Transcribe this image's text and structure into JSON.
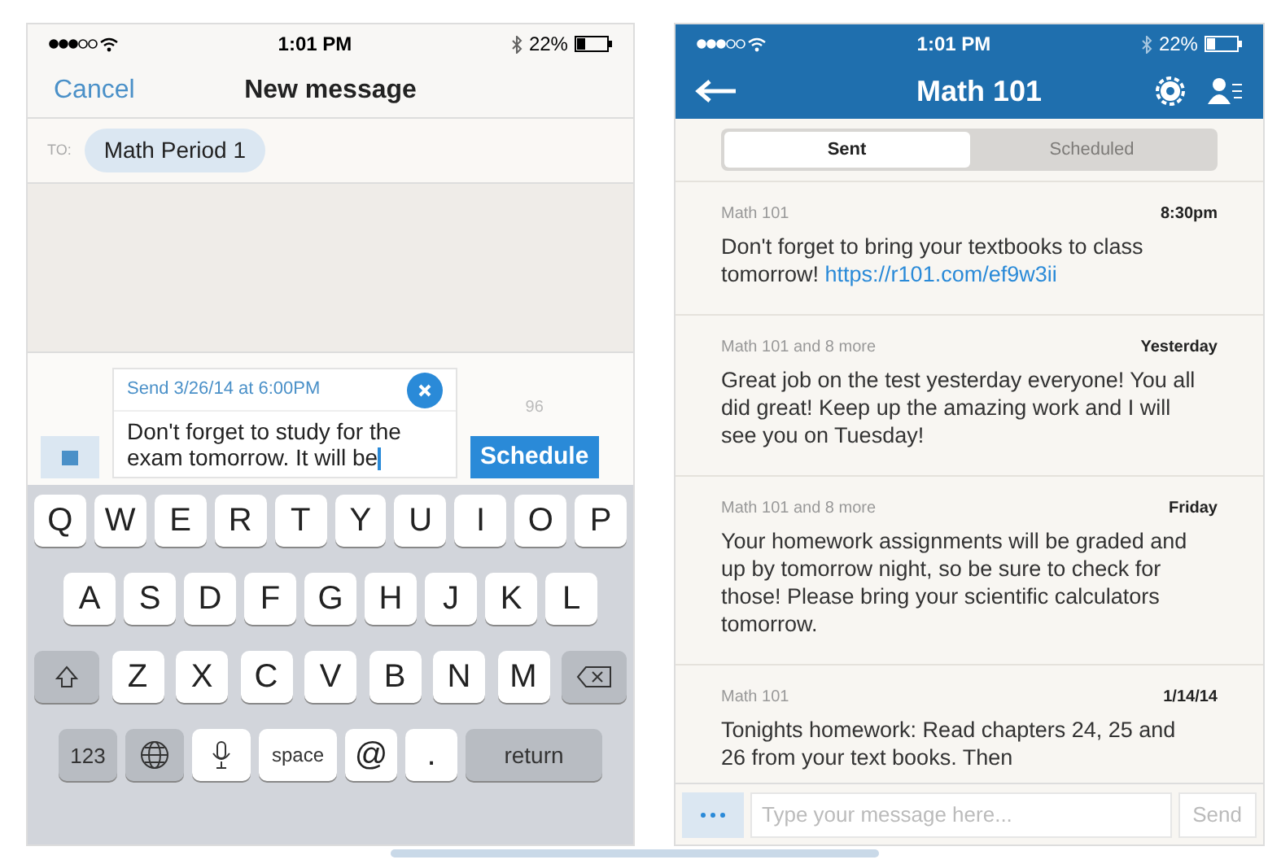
{
  "left": {
    "status_bar": {
      "time": "1:01 PM",
      "battery": "22%"
    },
    "nav": {
      "cancel": "Cancel",
      "title": "New message"
    },
    "to": {
      "label": "TO:",
      "recipient": "Math Period 1"
    },
    "compose": {
      "schedule_note": "Send 3/26/14 at 6:00PM",
      "text": "Don't forget to study for the exam tomorrow. It will be",
      "char_count": "96",
      "schedule_button": "Schedule"
    },
    "keyboard": {
      "rows": [
        {
          "keys": [
            {
              "kind": "letter",
              "label": "Q"
            },
            {
              "kind": "letter",
              "label": "W"
            },
            {
              "kind": "letter",
              "label": "E"
            },
            {
              "kind": "letter",
              "label": "R"
            },
            {
              "kind": "letter",
              "label": "T"
            },
            {
              "kind": "letter",
              "label": "Y"
            },
            {
              "kind": "letter",
              "label": "U"
            },
            {
              "kind": "letter",
              "label": "I"
            },
            {
              "kind": "letter",
              "label": "O"
            },
            {
              "kind": "letter",
              "label": "P"
            }
          ]
        },
        {
          "keys": [
            {
              "kind": "letter",
              "label": "A"
            },
            {
              "kind": "letter",
              "label": "S"
            },
            {
              "kind": "letter",
              "label": "D"
            },
            {
              "kind": "letter",
              "label": "F"
            },
            {
              "kind": "letter",
              "label": "G"
            },
            {
              "kind": "letter",
              "label": "H"
            },
            {
              "kind": "letter",
              "label": "J"
            },
            {
              "kind": "letter",
              "label": "K"
            },
            {
              "kind": "letter",
              "label": "L"
            }
          ]
        },
        {
          "keys": [
            {
              "kind": "shift"
            },
            {
              "kind": "letter",
              "label": "Z"
            },
            {
              "kind": "letter",
              "label": "X"
            },
            {
              "kind": "letter",
              "label": "C"
            },
            {
              "kind": "letter",
              "label": "V"
            },
            {
              "kind": "letter",
              "label": "B"
            },
            {
              "kind": "letter",
              "label": "N"
            },
            {
              "kind": "letter",
              "label": "M"
            },
            {
              "kind": "delete"
            }
          ]
        },
        {
          "keys": [
            {
              "kind": "function",
              "label": "123"
            },
            {
              "kind": "globe"
            },
            {
              "kind": "mic"
            },
            {
              "kind": "space",
              "label": "space"
            },
            {
              "kind": "letter",
              "label": "@"
            },
            {
              "kind": "letter",
              "label": "."
            },
            {
              "kind": "return",
              "label": "return"
            }
          ]
        }
      ]
    }
  },
  "right": {
    "status_bar": {
      "time": "1:01 PM",
      "battery": "22%"
    },
    "nav": {
      "title": "Math 101"
    },
    "tabs": [
      {
        "label": "Sent",
        "selected": true
      },
      {
        "label": "Scheduled",
        "selected": false
      }
    ],
    "messages": [
      {
        "to": "Math 101",
        "time": "8:30pm",
        "text": "Don't forget to bring your textbooks to class tomorrow!",
        "link": "https://r101.com/ef9w3ii"
      },
      {
        "to": "Math 101 and 8 more",
        "time": "Yesterday",
        "text": "Great job on the test yesterday everyone! You all did great! Keep up the amazing work and I will see you on Tuesday!"
      },
      {
        "to": "Math 101 and 8 more",
        "time": "Friday",
        "text": "Your homework assignments will be graded and up by tomorrow night, so be sure to check for those! Please bring your scientific calculators tomorrow."
      },
      {
        "to": "Math 101",
        "time": "1/14/14",
        "text": "Tonights homework: Read chapters 24, 25 and 26 from your text books. Then"
      }
    ],
    "input": {
      "placeholder": "Type your message here...",
      "send": "Send"
    }
  }
}
